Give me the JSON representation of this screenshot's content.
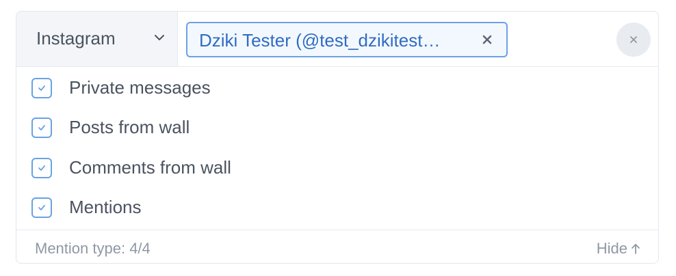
{
  "filter": {
    "platform": {
      "label": "Instagram",
      "icon": "chevron-down-icon"
    },
    "account_chip": {
      "label": "Dziki Tester (@test_dzikitest…",
      "remove_icon": "close-icon"
    },
    "clear_icon": "close-icon"
  },
  "options": [
    {
      "label": "Private messages",
      "checked": true
    },
    {
      "label": "Posts from wall",
      "checked": true
    },
    {
      "label": "Comments from wall",
      "checked": true
    },
    {
      "label": "Mentions",
      "checked": true
    }
  ],
  "footer": {
    "mention_type": "Mention type: 4/4",
    "hide_label": "Hide",
    "hide_icon": "arrow-up-icon"
  },
  "colors": {
    "accent": "#6aa1e6",
    "accent_text": "#2f6cc1",
    "text": "#4a5360",
    "muted": "#8f98a4"
  }
}
